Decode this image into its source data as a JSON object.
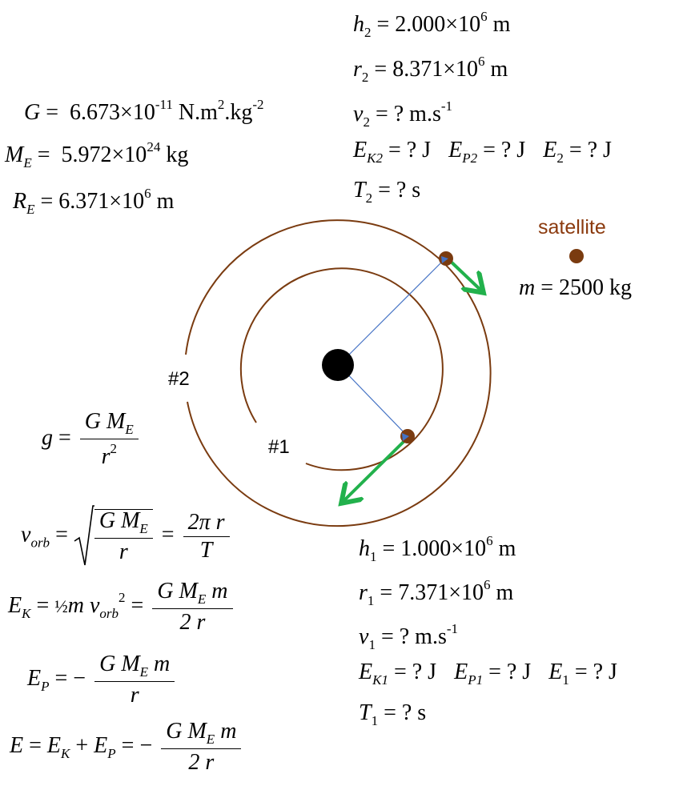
{
  "constants": {
    "G": {
      "label": "G",
      "value": "6.673×10",
      "exp": "-11",
      "unit_a": "N.m",
      "unit_sup": "2",
      "unit_b": ".kg",
      "unit_sup2": "-2"
    },
    "ME": {
      "label": "M",
      "sub": "E",
      "value": "5.972×10",
      "exp": "24",
      "unit": "kg"
    },
    "RE": {
      "label": "R",
      "sub": "E",
      "value": "6.371×10",
      "exp": "6",
      "unit": "m"
    }
  },
  "orbit2": {
    "h": {
      "label": "h",
      "sub": "2",
      "value": "2.000×10",
      "exp": "6",
      "unit": "m"
    },
    "r": {
      "label": "r",
      "sub": "2",
      "value": "8.371×10",
      "exp": "6",
      "unit": "m"
    },
    "v": {
      "label": "v",
      "sub": "2",
      "value": "? m.s",
      "exp": "-1"
    },
    "EK": {
      "label": "E",
      "sub": "K2",
      "value": "? J"
    },
    "EP": {
      "label": "E",
      "sub": "P2",
      "value": "? J"
    },
    "E": {
      "label": "E",
      "sub": "2",
      "value": "? J"
    },
    "T": {
      "label": "T",
      "sub": "2",
      "value": "? s"
    }
  },
  "orbit1": {
    "h": {
      "label": "h",
      "sub": "1",
      "value": "1.000×10",
      "exp": "6",
      "unit": "m"
    },
    "r": {
      "label": "r",
      "sub": "1",
      "value": "7.371×10",
      "exp": "6",
      "unit": "m"
    },
    "v": {
      "label": "v",
      "sub": "1",
      "value": "? m.s",
      "exp": "-1"
    },
    "EK": {
      "label": "E",
      "sub": "K1",
      "value": "? J"
    },
    "EP": {
      "label": "E",
      "sub": "P1",
      "value": "? J"
    },
    "E": {
      "label": "E",
      "sub": "1",
      "value": "? J"
    },
    "T": {
      "label": "T",
      "sub": "1",
      "value": "? s"
    }
  },
  "satellite": {
    "label": "satellite",
    "mass_label": "m",
    "mass_value": "2500 kg"
  },
  "diagram": {
    "orbit1_label": "#1",
    "orbit2_label": "#2",
    "colors": {
      "orbit": "#7a3b10",
      "radius_line": "#4472c4",
      "velocity": "#22b14c",
      "satellite": "#7a3b10",
      "earth": "#000000",
      "satellite_marker": "#4472c4",
      "satellite_text": "#8b3a0e"
    }
  },
  "formulas": {
    "g": {
      "lhs": "g",
      "num_a": "G M",
      "num_sub": "E",
      "den_a": "r",
      "den_sup": "2"
    },
    "vorb": {
      "lhs": "v",
      "lhs_sub": "orb",
      "root_num_a": "G M",
      "root_num_sub": "E",
      "root_den": "r",
      "frac2_num": "2π r",
      "frac2_den": "T"
    },
    "EK": {
      "lhs": "E",
      "lhs_sub": "K",
      "half": "½",
      "mid_a": "m v",
      "mid_sub": "orb",
      "mid_sup": "2",
      "num_a": "G M",
      "num_sub": "E",
      "num_b": " m",
      "den": "2 r"
    },
    "EP": {
      "lhs": "E",
      "lhs_sub": "P",
      "sign": "−",
      "num_a": "G M",
      "num_sub": "E",
      "num_b": " m",
      "den": "r"
    },
    "E": {
      "lhs": "E",
      "t1": "E",
      "t1_sub": "K",
      "t2": "E",
      "t2_sub": "P",
      "sign": "−",
      "num_a": "G M",
      "num_sub": "E",
      "num_b": " m",
      "den": "2 r"
    }
  }
}
